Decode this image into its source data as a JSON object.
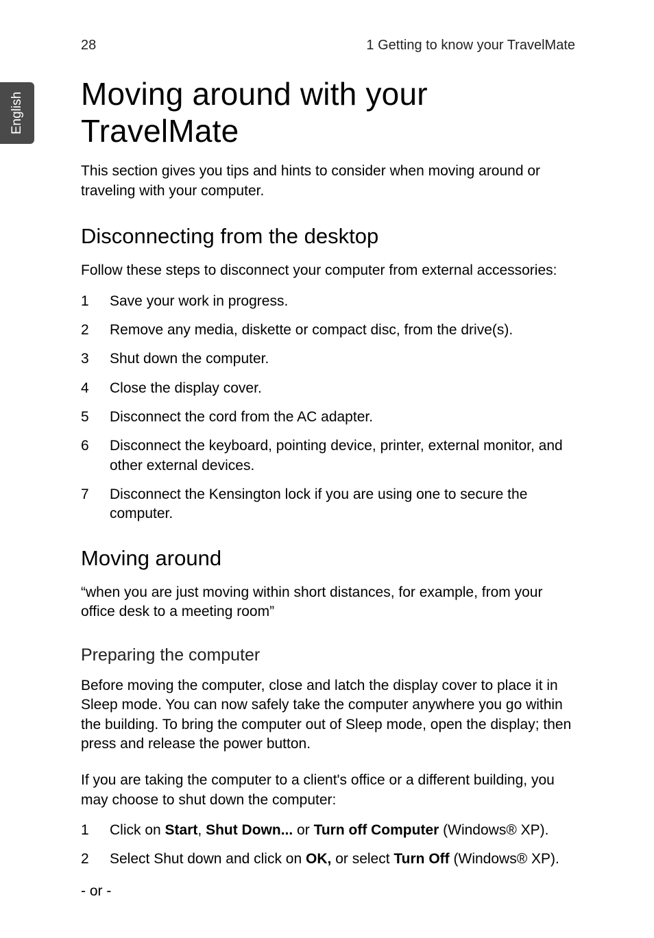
{
  "header": {
    "page_number": "28",
    "running_title": "1 Getting to know your TravelMate"
  },
  "side_tab": {
    "label": "English"
  },
  "title": "Moving around with your TravelMate",
  "intro": "This section gives you tips and hints to consider when moving around or traveling with your computer.",
  "section_disconnect": {
    "heading": "Disconnecting from the desktop",
    "lead": "Follow these steps to disconnect your computer from external accessories:",
    "steps": [
      "Save your work in progress.",
      "Remove any media, diskette or compact disc, from the drive(s).",
      "Shut down the computer.",
      "Close the display cover.",
      "Disconnect the cord from the AC adapter.",
      "Disconnect the keyboard, pointing device, printer, external monitor, and other external devices.",
      "Disconnect the Kensington lock if you are using one to secure the computer."
    ]
  },
  "section_moving": {
    "heading": "Moving around",
    "quote": "“when you are just moving within short distances, for example, from your office desk to a meeting room”",
    "sub_preparing_heading": "Preparing the computer",
    "para1": "Before moving the computer, close and latch the display cover to place it in Sleep mode. You can now safely take the computer anywhere you go within the building. To bring the computer out of Sleep mode, open the display; then press and release the power button.",
    "para2": "If you are taking the computer to a client's office or a different building, you may choose to shut down the computer:",
    "steps": [
      {
        "pre1": "Click on ",
        "b1": "Start",
        "sep1": ", ",
        "b2": "Shut Down...",
        "mid": " or ",
        "b3": "Turn off Computer",
        "post": " (Windows® XP)."
      },
      {
        "pre1": "Select Shut down and click on ",
        "b1": "OK,",
        "mid": " or select ",
        "b2": "Turn Off",
        "post": " (Windows® XP)."
      }
    ],
    "or_text": "- or -"
  }
}
